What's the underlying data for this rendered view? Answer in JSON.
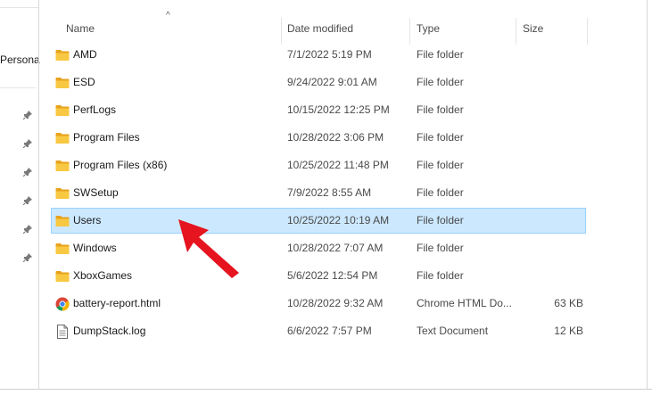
{
  "nav": {
    "partial_label": "Persona",
    "pins": [
      "pin",
      "pin",
      "pin",
      "pin",
      "pin",
      "pin"
    ]
  },
  "columns": {
    "name": "Name",
    "date_modified": "Date modified",
    "type": "Type",
    "size": "Size",
    "sort_indicator": "^"
  },
  "files": [
    {
      "name": "AMD",
      "date": "7/1/2022 5:19 PM",
      "type": "File folder",
      "size": "",
      "icon": "folder-icon"
    },
    {
      "name": "ESD",
      "date": "9/24/2022 9:01 AM",
      "type": "File folder",
      "size": "",
      "icon": "folder-icon"
    },
    {
      "name": "PerfLogs",
      "date": "10/15/2022 12:25 PM",
      "type": "File folder",
      "size": "",
      "icon": "folder-icon"
    },
    {
      "name": "Program Files",
      "date": "10/28/2022 3:06 PM",
      "type": "File folder",
      "size": "",
      "icon": "folder-icon"
    },
    {
      "name": "Program Files (x86)",
      "date": "10/25/2022 11:48 PM",
      "type": "File folder",
      "size": "",
      "icon": "folder-icon"
    },
    {
      "name": "SWSetup",
      "date": "7/9/2022 8:55 AM",
      "type": "File folder",
      "size": "",
      "icon": "folder-icon"
    },
    {
      "name": "Users",
      "date": "10/25/2022 10:19 AM",
      "type": "File folder",
      "size": "",
      "icon": "folder-icon",
      "selected": true
    },
    {
      "name": "Windows",
      "date": "10/28/2022 7:07 AM",
      "type": "File folder",
      "size": "",
      "icon": "folder-icon"
    },
    {
      "name": "XboxGames",
      "date": "5/6/2022 12:54 PM",
      "type": "File folder",
      "size": "",
      "icon": "folder-icon"
    },
    {
      "name": "battery-report.html",
      "date": "10/28/2022 9:32 AM",
      "type": "Chrome HTML Do...",
      "size": "63 KB",
      "icon": "chrome-icon"
    },
    {
      "name": "DumpStack.log",
      "date": "6/6/2022 7:57 PM",
      "type": "Text Document",
      "size": "12 KB",
      "icon": "text-file-icon"
    }
  ],
  "colors": {
    "folder": "#f8c842",
    "folder_dark": "#e8a21c",
    "selection": "#cce8ff",
    "selection_border": "#99d1ff",
    "annotation_arrow": "#e5141f"
  }
}
